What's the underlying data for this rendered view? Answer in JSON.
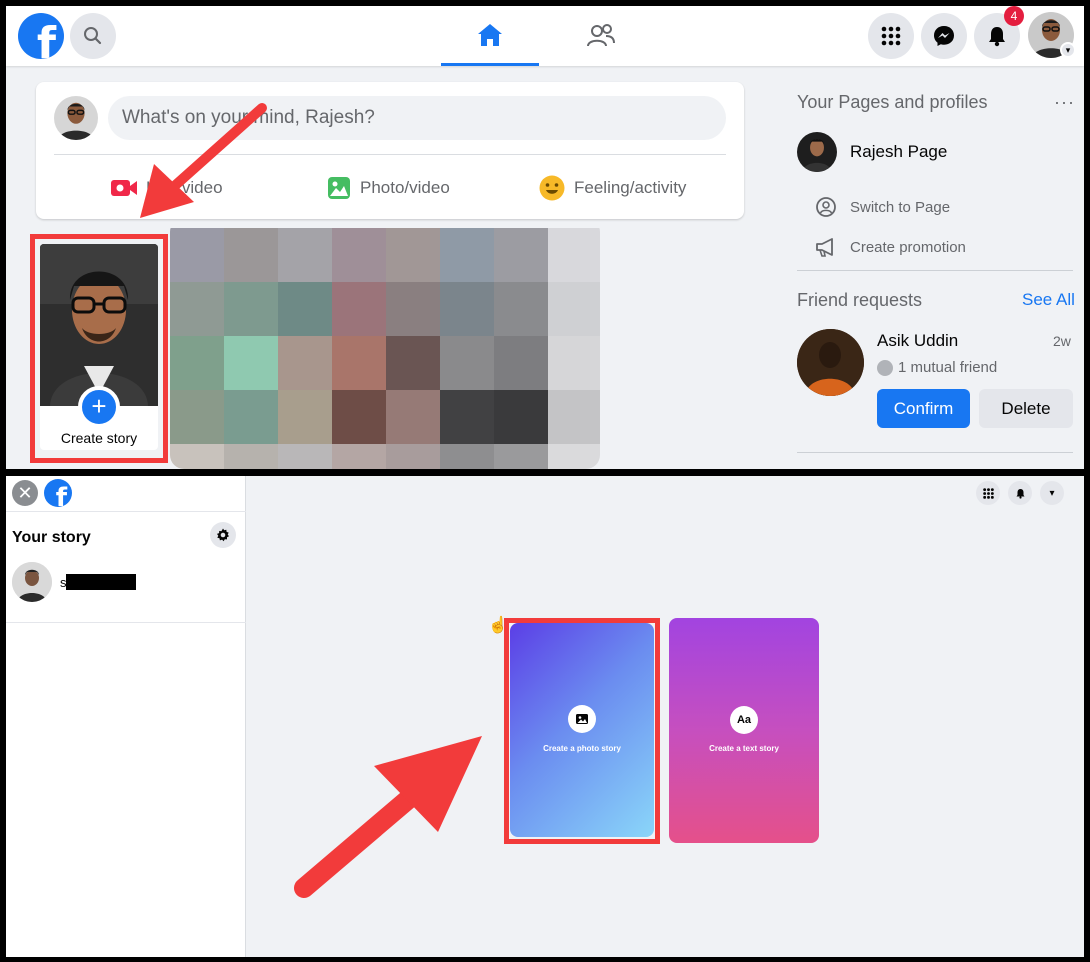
{
  "colors": {
    "brand": "#1877f2",
    "highlight": "#f23b3b",
    "badge": "#e41e3f"
  },
  "top": {
    "navbar": {
      "logo_icon": "facebook-logo",
      "search_icon": "search-icon",
      "home_icon": "home-icon",
      "friends_icon": "friends-icon",
      "menu_icon": "menu-grid-icon",
      "messenger_icon": "messenger-icon",
      "bell_icon": "bell-icon",
      "notif_count": "4"
    },
    "composer": {
      "placeholder": "What's on your mind, Rajesh?",
      "actions": [
        {
          "label": "Live video",
          "icon": "video-camera-icon"
        },
        {
          "label": "Photo/video",
          "icon": "photo-icon"
        },
        {
          "label": "Feeling/activity",
          "icon": "smile-icon"
        }
      ]
    },
    "story": {
      "create_label": "Create story",
      "plus": "+"
    },
    "right": {
      "pages_title": "Your Pages and profiles",
      "more": "···",
      "page_name": "Rajesh Page",
      "switch_label": "Switch to Page",
      "promo_label": "Create promotion",
      "fr_title": "Friend requests",
      "see_all": "See All",
      "fr_name": "Asik Uddin",
      "fr_time": "2w",
      "fr_mutual": "1 mutual friend",
      "confirm": "Confirm",
      "delete": "Delete"
    }
  },
  "bottom": {
    "close": "✕",
    "sidebar_title": "Your story",
    "user_initial": "s",
    "photo_card": {
      "icon": "photo-icon",
      "label": "Create a photo story"
    },
    "text_card": {
      "icon_text": "Aa",
      "label": "Create a text story"
    }
  }
}
